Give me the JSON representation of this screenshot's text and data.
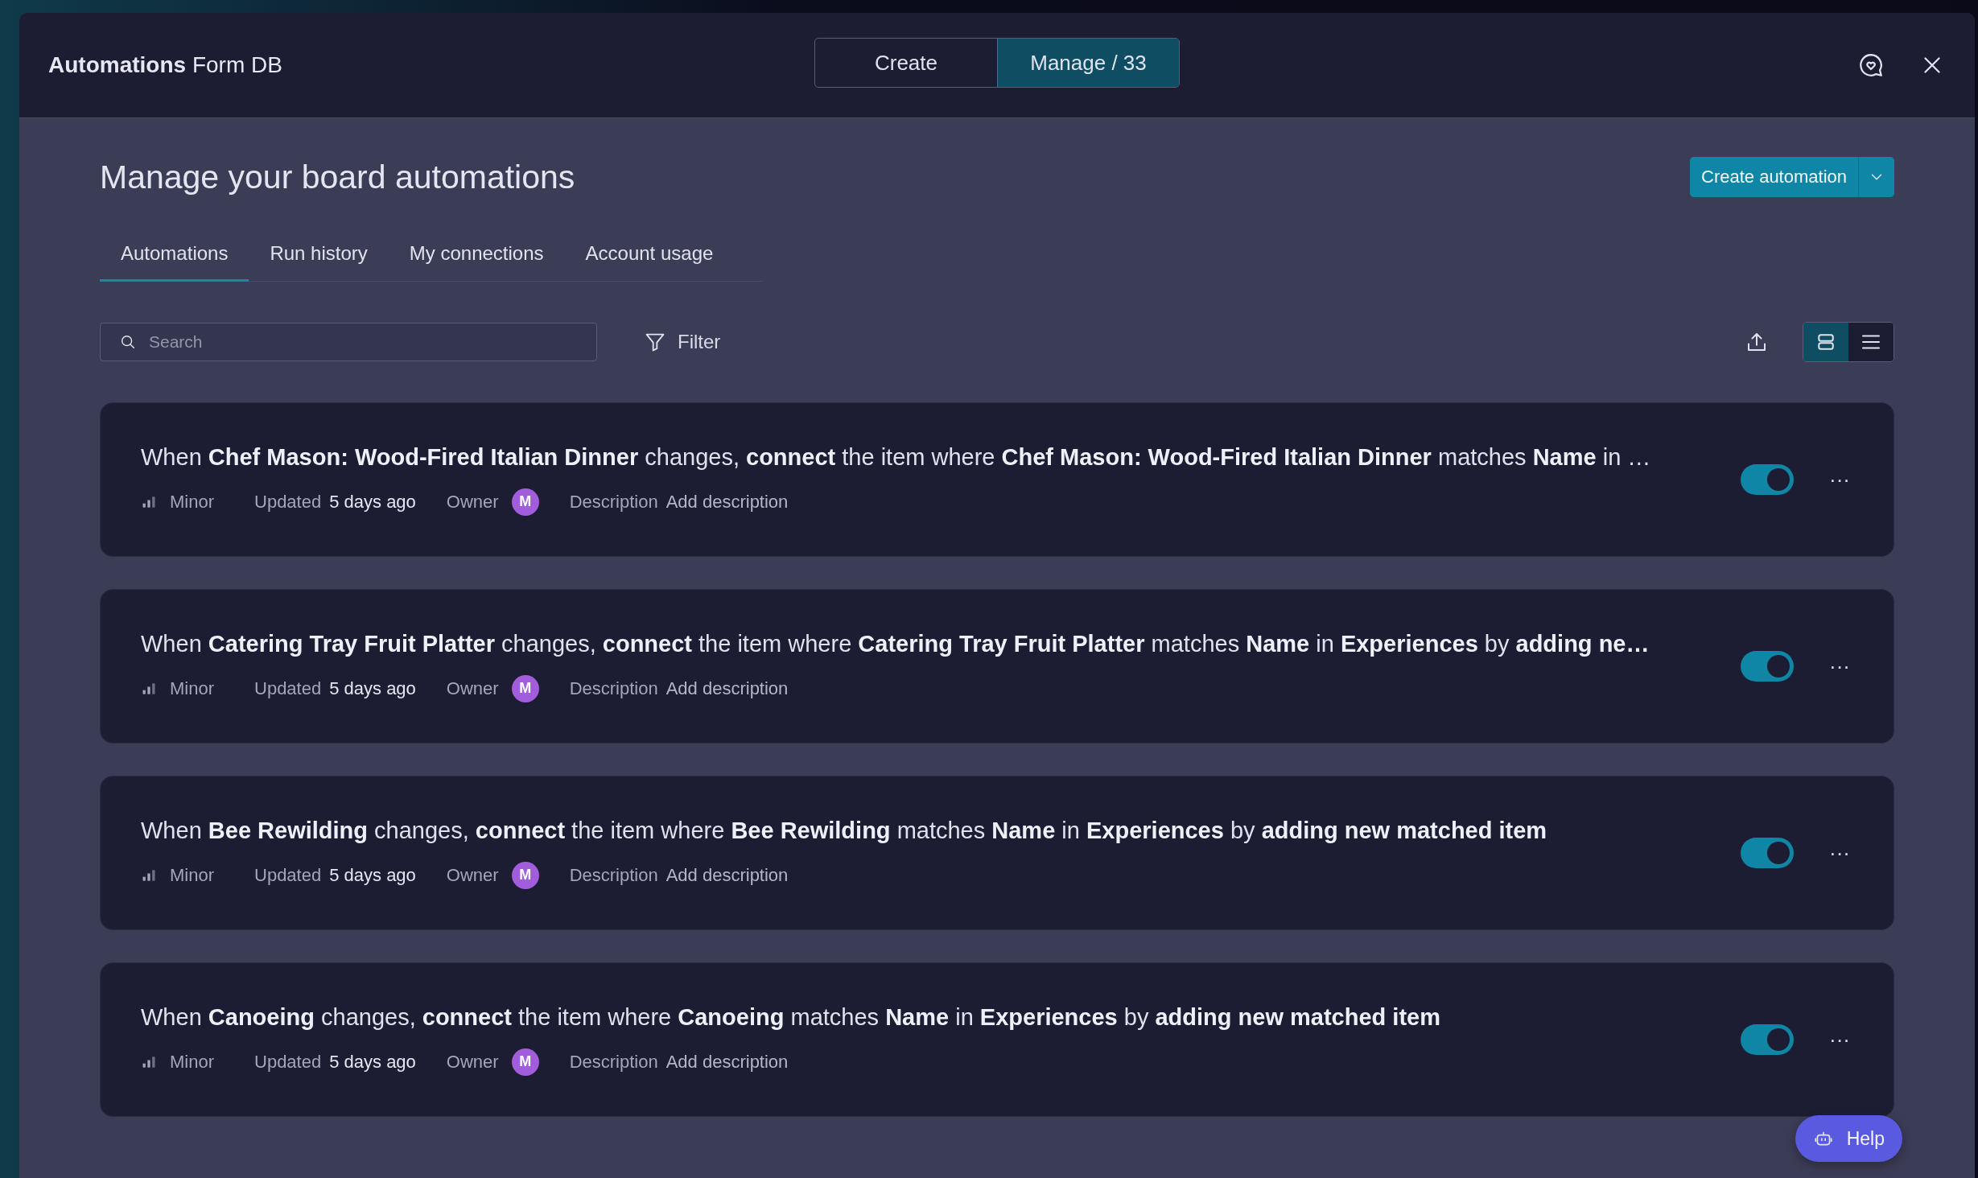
{
  "window": {
    "title": "Automations",
    "subtitle": "Form DB"
  },
  "mode_tabs": [
    {
      "label": "Create",
      "selected": false
    },
    {
      "label": "Manage / 33",
      "selected": true
    }
  ],
  "page": {
    "heading": "Manage your board automations",
    "create_button": "Create automation"
  },
  "tabs": [
    {
      "label": "Automations",
      "selected": true
    },
    {
      "label": "Run history",
      "selected": false
    },
    {
      "label": "My connections",
      "selected": false
    },
    {
      "label": "Account usage",
      "selected": false
    }
  ],
  "search": {
    "placeholder": "Search"
  },
  "filter": "Filter",
  "views": [
    {
      "kind": "cards",
      "selected": true
    },
    {
      "kind": "list",
      "selected": false
    }
  ],
  "automations": [
    {
      "text": "When **Chef Mason: Wood-Fired Italian Dinner** changes, **connect** the item where **Chef Mason: Wood-Fired Italian Dinner** matches **Name** in …",
      "on": true,
      "priority": "Minor",
      "updated_label": "Updated",
      "updated": "5 days ago",
      "owner_label": "Owner",
      "owner_initial": "M",
      "description_label": "Description",
      "description": "Add description",
      "more": "···"
    },
    {
      "text": "When **Catering Tray Fruit Platter** changes, **connect** the item where **Catering Tray Fruit Platter** matches **Name** in **Experiences** by **adding ne…**",
      "on": true,
      "priority": "Minor",
      "updated_label": "Updated",
      "updated": "5 days ago",
      "owner_label": "Owner",
      "owner_initial": "M",
      "description_label": "Description",
      "description": "Add description",
      "more": "···"
    },
    {
      "text": "When **Bee Rewilding** changes, **connect** the item where **Bee Rewilding** matches **Name** in **Experiences** by **adding new matched item**",
      "on": true,
      "priority": "Minor",
      "updated_label": "Updated",
      "updated": "5 days ago",
      "owner_label": "Owner",
      "owner_initial": "M",
      "description_label": "Description",
      "description": "Add description",
      "more": "···"
    },
    {
      "text": "When **Canoeing** changes, **connect** the item where **Canoeing** matches **Name** in **Experiences** by **adding new matched item**",
      "on": true,
      "priority": "Minor",
      "updated_label": "Updated",
      "updated": "5 days ago",
      "owner_label": "Owner",
      "owner_initial": "M",
      "description_label": "Description",
      "description": "Add description",
      "more": "···"
    }
  ],
  "help_button": "Help"
}
